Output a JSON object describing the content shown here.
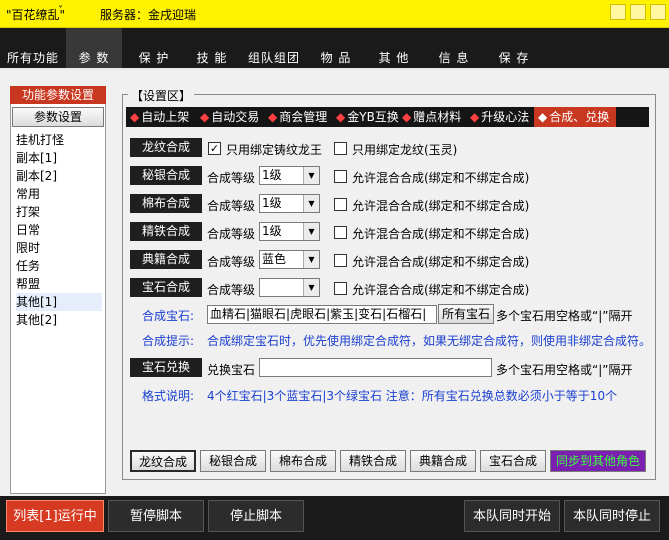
{
  "window": {
    "title": "\"百花缭乱\"",
    "server": "服务器：金戌迎瑞"
  },
  "menu": [
    "所有功能",
    "参 数",
    "保 护",
    "技 能",
    "组队组团",
    "物 品",
    "其 他",
    "信 息",
    "保 存"
  ],
  "left_panel": {
    "title": "功能参数设置",
    "button": "参数设置",
    "items": [
      "挂机打怪",
      "副本[1]",
      "副本[2]",
      "常用",
      "打架",
      "日常",
      "限时",
      "任务",
      "帮盟",
      "其他[1]",
      "其他[2]"
    ],
    "selected": "其他[1]"
  },
  "settings": {
    "group_label": "【设置区】",
    "tabs": [
      "自动上架",
      "自动交易",
      "商会管理",
      "金YB互换",
      "赠点材料",
      "升级心法",
      "合成、兑换"
    ],
    "active_tab": "合成、兑换",
    "rows": [
      {
        "label": "龙纹合成",
        "check1": "只用绑定铸纹龙王",
        "check1_checked": true,
        "check2": "只用绑定龙纹(玉灵)"
      },
      {
        "label": "秘银合成",
        "level_label": "合成等级",
        "level": "1级",
        "check": "允许混合合成(绑定和不绑定合成)"
      },
      {
        "label": "棉布合成",
        "level_label": "合成等级",
        "level": "1级",
        "check": "允许混合合成(绑定和不绑定合成)"
      },
      {
        "label": "精铁合成",
        "level_label": "合成等级",
        "level": "1级",
        "check": "允许混合合成(绑定和不绑定合成)"
      },
      {
        "label": "典籍合成",
        "level_label": "合成等级",
        "level": "蓝色",
        "check": "允许混合合成(绑定和不绑定合成)"
      },
      {
        "label": "宝石合成",
        "level_label": "合成等级",
        "level": "",
        "check": "允许混合合成(绑定和不绑定合成)"
      }
    ],
    "gem_compose_label": "合成宝石:",
    "gem_list": "血精石|猫眼石|虎眼石|紫玉|变石|石榴石|",
    "all_gems_button": "所有宝石",
    "gem_separator_hint": "多个宝石用空格或“|”隔开",
    "compose_tip_label": "合成提示:",
    "compose_tip": "合成绑定宝石时，优先使用绑定合成符，如果无绑定合成符，则使用非绑定合成符。",
    "exchange_label": "宝石兑换",
    "exchange_field_label": "兑换宝石",
    "exchange_value": "",
    "exchange_hint": "多个宝石用空格或“|”隔开",
    "format_label": "格式说明:",
    "format_text": "4个红宝石|3个蓝宝石|3个绿宝石  注意：所有宝石兑换总数必须小于等于10个",
    "bottom_tabs": [
      "龙纹合成",
      "秘银合成",
      "棉布合成",
      "精铁合成",
      "典籍合成",
      "宝石合成",
      "同步到其他角色"
    ]
  },
  "footer": {
    "status": "列表[1]运行中",
    "pause": "暂停脚本",
    "stop": "停止脚本",
    "team_start": "本队同时开始",
    "team_stop": "本队同时停止"
  },
  "colors": {
    "accent_red": "#c8371f",
    "title_yellow": "#fff200",
    "dark": "#1a1a1a",
    "link_blue": "#1a3fd0",
    "sync_purple": "#7a1fb0"
  }
}
